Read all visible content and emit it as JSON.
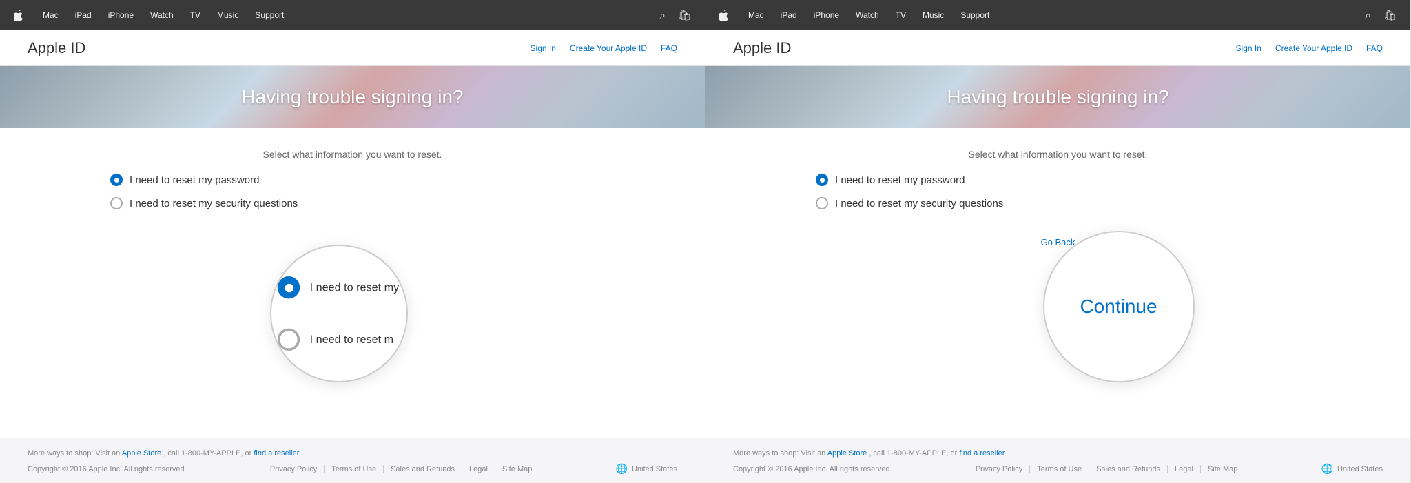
{
  "nav": {
    "apple_icon": "&#xf8ff;",
    "items": [
      {
        "label": "Mac",
        "name": "mac"
      },
      {
        "label": "iPad",
        "name": "ipad"
      },
      {
        "label": "iPhone",
        "name": "iphone"
      },
      {
        "label": "Watch",
        "name": "watch"
      },
      {
        "label": "TV",
        "name": "tv"
      },
      {
        "label": "Music",
        "name": "music"
      },
      {
        "label": "Support",
        "name": "support"
      }
    ]
  },
  "subheader": {
    "title": "Apple ID",
    "sign_in": "Sign In",
    "create": "Create Your Apple ID",
    "faq": "FAQ"
  },
  "hero": {
    "title": "Having trouble signing in?"
  },
  "left_panel": {
    "subtitle": "Select what information you want to reset.",
    "radio1_label": "I need to reset my password",
    "radio2_label": "I need to reset my security questions",
    "radio1_selected": true,
    "radio2_selected": false
  },
  "right_panel": {
    "subtitle": "Select what information you want to reset.",
    "radio1_label": "I need to reset my password",
    "radio2_label": "I need to reset my security questions",
    "radio1_selected": true,
    "radio2_selected": false,
    "go_back": "Go Back",
    "continue": "Continue"
  },
  "footer": {
    "more_ways": "More ways to shop: Visit an",
    "apple_store": "Apple Store",
    "call": ", call 1-800-MY-APPLE, or",
    "find_reseller": "find a reseller",
    "copyright": "Copyright © 2016 Apple Inc. All rights reserved.",
    "privacy": "Privacy Policy",
    "terms": "Terms of Use",
    "sales": "Sales and Refunds",
    "legal": "Legal",
    "site_map": "Site Map",
    "region": "United States"
  }
}
